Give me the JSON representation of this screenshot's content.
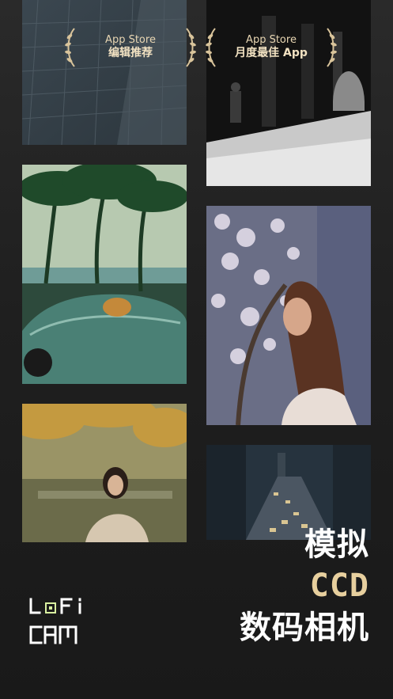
{
  "badges": [
    {
      "store": "App Store",
      "award": "编辑推荐"
    },
    {
      "store": "App Store",
      "award": "月度最佳 App"
    }
  ],
  "headline": {
    "line1": "模拟",
    "line2": "CCD",
    "line3": "数码相机"
  },
  "logo": {
    "line1": "LoFi",
    "line2": "CAM",
    "accent_color": "#d9f0a0"
  },
  "colors": {
    "gold": "#e7cf9e",
    "background": "#1f1f1f"
  },
  "photos": [
    {
      "name": "building-glass-facade"
    },
    {
      "name": "arcade-street-bw"
    },
    {
      "name": "convertible-palm-beach"
    },
    {
      "name": "girl-blossom-tree"
    },
    {
      "name": "girl-autumn-leaves"
    },
    {
      "name": "city-traffic-night"
    }
  ]
}
